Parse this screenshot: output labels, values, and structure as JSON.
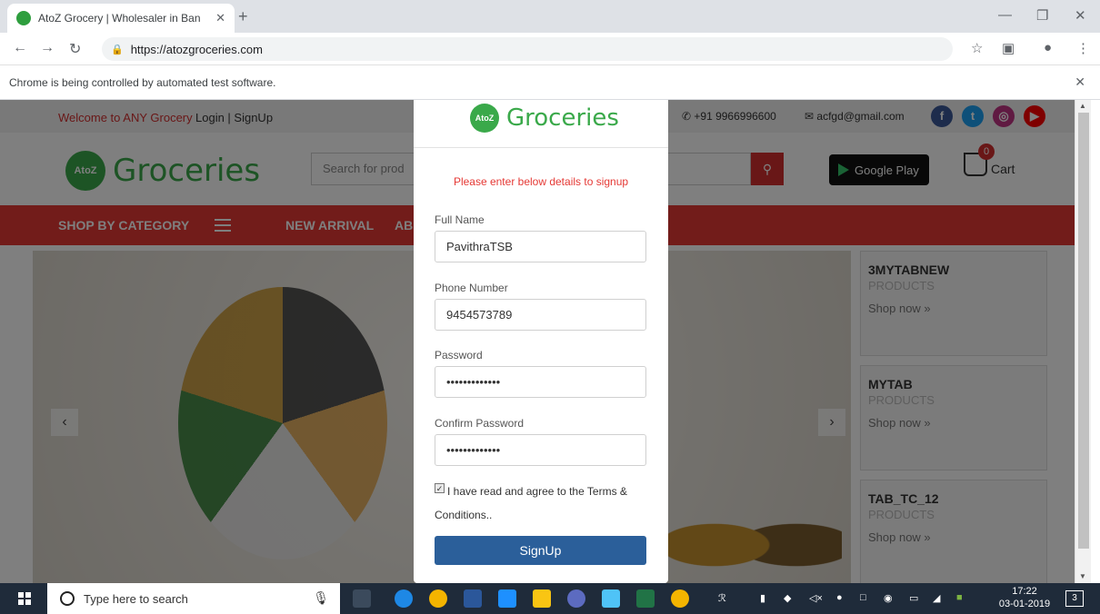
{
  "browser": {
    "tab_title": "AtoZ Grocery | Wholesaler in Ban",
    "url": "https://atozgroceries.com",
    "infobar": "Chrome is being controlled by automated test software."
  },
  "site": {
    "welcome": "Welcome to ANY Grocery",
    "login_signup": "Login | SignUp",
    "phone": "+91 9966996600",
    "email": "acfgd@gmail.com",
    "logo_text": "Groceries",
    "logo_badge": "AtoZ",
    "search_placeholder": "Search for prod",
    "google_play": "Google Play",
    "cart_label": "Cart",
    "cart_count": "0",
    "nav": {
      "shop_by_category": "SHOP BY CATEGORY",
      "new_arrival": "NEW ARRIVAL",
      "ab": "AB"
    },
    "side_cards": [
      {
        "title": "3MYTABNEW",
        "sub": "PRODUCTS",
        "link": "Shop now »"
      },
      {
        "title": "MYTAB",
        "sub": "PRODUCTS",
        "link": "Shop now »"
      },
      {
        "title": "TAB_TC_12",
        "sub": "PRODUCTS",
        "link": "Shop now »"
      }
    ]
  },
  "modal": {
    "logo_text": "Groceries",
    "subtitle": "Please enter below details to signup",
    "full_name_label": "Full Name",
    "full_name_value": "PavithraTSB",
    "phone_label": "Phone Number",
    "phone_value": "9454573789",
    "password_label": "Password",
    "password_value": "•••••••••••••",
    "confirm_label": "Confirm Password",
    "confirm_value": "•••••••••••••",
    "terms": "I have read and agree to the Terms & Conditions..",
    "signup_button": "SignUp"
  },
  "taskbar": {
    "search_placeholder": "Type here to search",
    "time": "17:22",
    "date": "03-01-2019",
    "notifications": "3"
  },
  "colors": {
    "accent_red": "#e53935",
    "brand_green": "#3aa94a",
    "signup_blue": "#2b5f9a"
  }
}
